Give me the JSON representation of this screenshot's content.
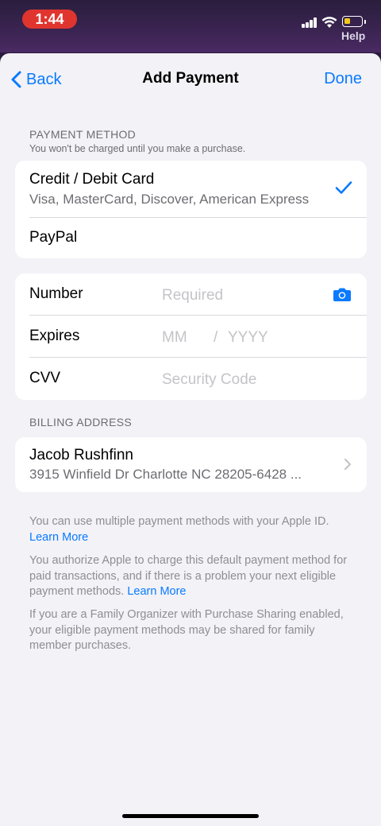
{
  "status_bar": {
    "time": "1:44",
    "back_to_app": "Help",
    "battery_percent": 35
  },
  "nav": {
    "back_label": "Back",
    "title": "Add Payment",
    "done_label": "Done"
  },
  "payment_method": {
    "header": "PAYMENT METHOD",
    "subheader": "You won't be charged until you make a purchase.",
    "options": [
      {
        "title": "Credit / Debit Card",
        "subtitle": "Visa, MasterCard, Discover, American Express",
        "selected": true
      },
      {
        "title": "PayPal",
        "subtitle": "",
        "selected": false
      }
    ]
  },
  "card_fields": {
    "number": {
      "label": "Number",
      "placeholder": "Required"
    },
    "expires": {
      "label": "Expires",
      "month_placeholder": "MM",
      "separator": "/",
      "year_placeholder": "YYYY"
    },
    "cvv": {
      "label": "CVV",
      "placeholder": "Security Code"
    }
  },
  "billing": {
    "header": "BILLING ADDRESS",
    "name": "Jacob Rushfinn",
    "address": "3915 Winfield Dr Charlotte NC 28205-6428 ..."
  },
  "footnotes": {
    "p1_text": "You can use multiple payment methods with your Apple ID.",
    "p1_link": "Learn More",
    "p2_text": "You authorize Apple to charge this default payment method for paid transactions, and if there is a problem your next eligible payment methods.",
    "p2_link": "Learn More",
    "p3_text": "If you are a Family Organizer with Purchase Sharing enabled, your eligible payment methods may be shared for family member purchases."
  },
  "colors": {
    "accent": "#0a7aff",
    "background": "#f2f2f7",
    "time_pill": "#e0352f"
  }
}
